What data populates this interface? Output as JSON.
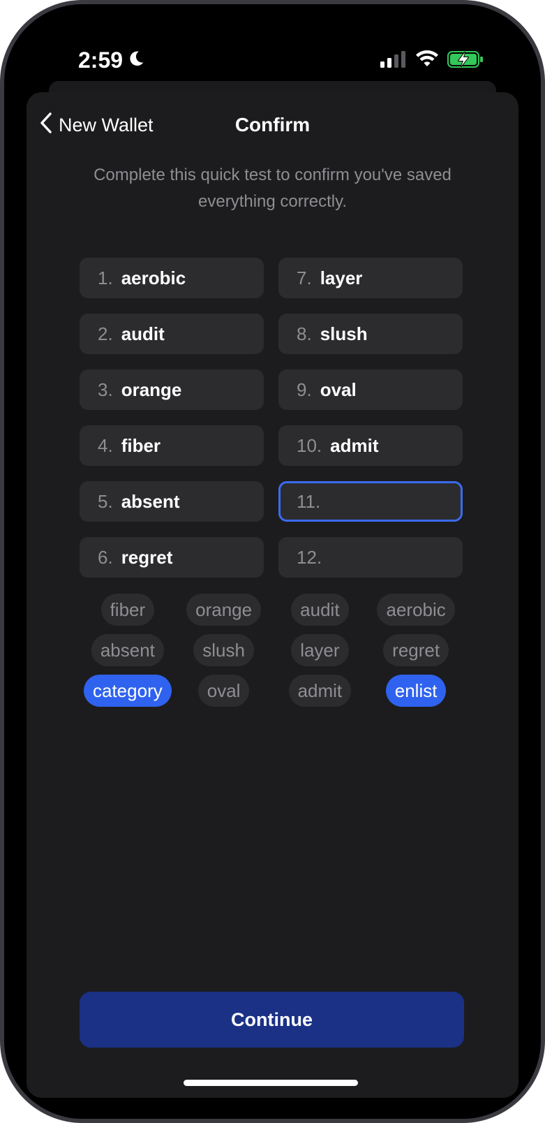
{
  "status_bar": {
    "time": "2:59",
    "icons": [
      "moon-icon",
      "cellular-signal-icon",
      "wifi-icon",
      "battery-charging-icon"
    ],
    "battery_color": "#34c759"
  },
  "nav": {
    "back_label": "New Wallet",
    "title": "Confirm"
  },
  "subtitle": "Complete this quick test to confirm you've saved everything correctly.",
  "slots": [
    {
      "number": "1.",
      "word": "aerobic"
    },
    {
      "number": "7.",
      "word": "layer"
    },
    {
      "number": "2.",
      "word": "audit"
    },
    {
      "number": "8.",
      "word": "slush"
    },
    {
      "number": "3.",
      "word": "orange"
    },
    {
      "number": "9.",
      "word": "oval"
    },
    {
      "number": "4.",
      "word": "fiber"
    },
    {
      "number": "10.",
      "word": "admit"
    },
    {
      "number": "5.",
      "word": "absent"
    },
    {
      "number": "11.",
      "word": "",
      "active": true
    },
    {
      "number": "6.",
      "word": "regret"
    },
    {
      "number": "12.",
      "word": ""
    }
  ],
  "word_chips": [
    [
      {
        "label": "fiber"
      },
      {
        "label": "orange"
      },
      {
        "label": "audit"
      },
      {
        "label": "aerobic"
      }
    ],
    [
      {
        "label": "absent"
      },
      {
        "label": "slush"
      },
      {
        "label": "layer"
      },
      {
        "label": "regret"
      }
    ],
    [
      {
        "label": "category",
        "selected": true
      },
      {
        "label": "oval"
      },
      {
        "label": "admit"
      },
      {
        "label": "enlist",
        "selected": true
      }
    ]
  ],
  "continue_label": "Continue",
  "colors": {
    "accent": "#2f62ee",
    "active_border": "#3a6cf0",
    "button": "#1a3185"
  }
}
